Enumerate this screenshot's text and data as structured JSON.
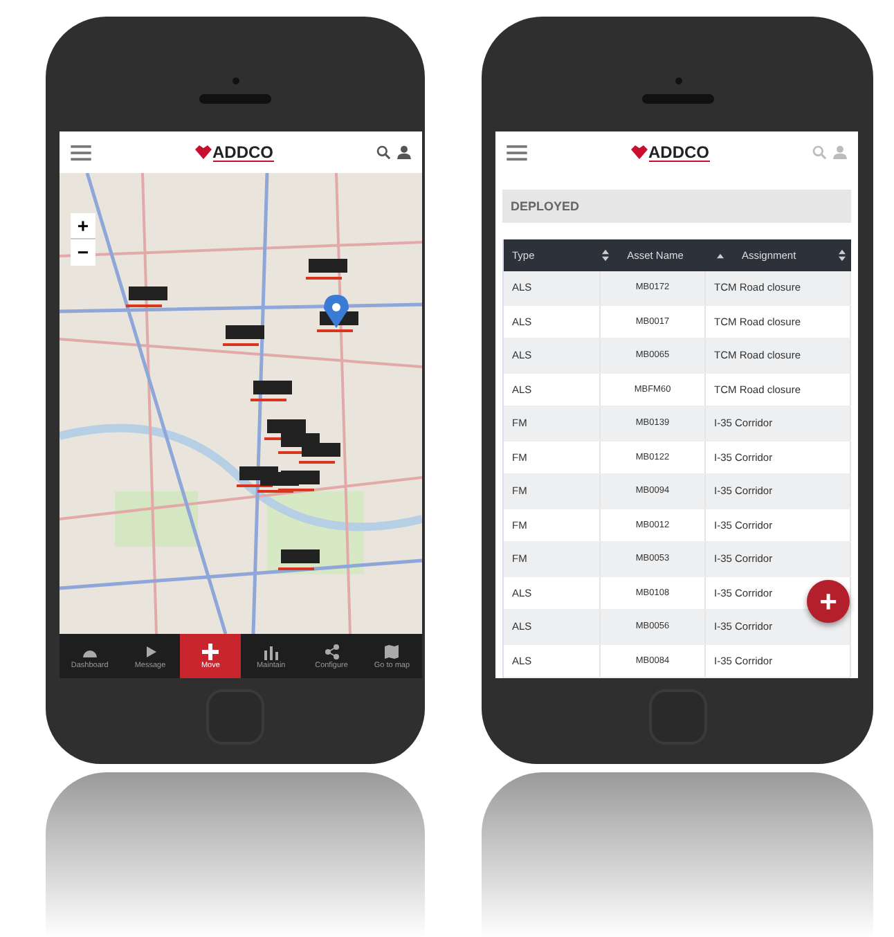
{
  "map_screen": {
    "header": {
      "logo": "ADDCO"
    },
    "zoom_controls": [
      "+",
      "−"
    ],
    "bottom_nav": [
      {
        "label": "Dashboard",
        "selected": false
      },
      {
        "label": "Message",
        "selected": false
      },
      {
        "label": "Move",
        "selected": true
      },
      {
        "label": "Maintain",
        "selected": false
      },
      {
        "label": "Configure",
        "selected": false
      },
      {
        "label": "Go to map",
        "selected": false
      }
    ]
  },
  "list_screen": {
    "header": {
      "logo": "ADDCO"
    },
    "section_title": "DEPLOYED",
    "table": {
      "columns": [
        {
          "label": "Type",
          "sorted": false
        },
        {
          "label": "Asset Name",
          "sorted": true
        },
        {
          "label": "Assignment",
          "sorted": false
        }
      ],
      "rows": [
        [
          "ALS",
          "MB0172",
          "TCM Road closure"
        ],
        [
          "ALS",
          "MB0017",
          "TCM Road closure"
        ],
        [
          "ALS",
          "MB0065",
          "TCM Road closure"
        ],
        [
          "ALS",
          "MBFM60",
          "TCM Road closure"
        ],
        [
          "FM",
          "MB0139",
          "I-35 Corridor"
        ],
        [
          "FM",
          "MB0122",
          "I-35 Corridor"
        ],
        [
          "FM",
          "MB0094",
          "I-35 Corridor"
        ],
        [
          "FM",
          "MB0012",
          "I-35 Corridor"
        ],
        [
          "FM",
          "MB0053",
          "I-35 Corridor"
        ],
        [
          "ALS",
          "MB0108",
          "I-35 Corridor"
        ],
        [
          "ALS",
          "MB0056",
          "I-35 Corridor"
        ],
        [
          "ALS",
          "MB0084",
          "I-35 Corridor"
        ]
      ]
    },
    "fab": "+"
  }
}
